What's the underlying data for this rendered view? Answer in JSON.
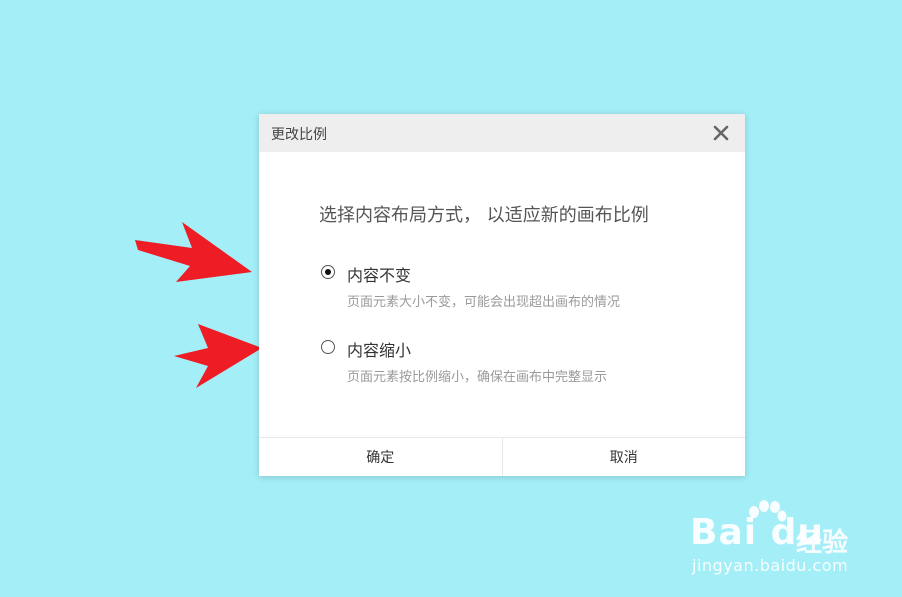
{
  "dialog": {
    "title": "更改比例",
    "prompt": "选择内容布局方式， 以适应新的画布比例",
    "options": [
      {
        "label": "内容不变",
        "description": "页面元素大小不变，可能会出现超出画布的情况",
        "checked": true
      },
      {
        "label": "内容缩小",
        "description": "页面元素按比例缩小，确保在画布中完整显示",
        "checked": false
      }
    ],
    "confirm_label": "确定",
    "cancel_label": "取消",
    "close_icon": "close-icon"
  },
  "watermark": {
    "logo_text": "Bai du",
    "jingyan_text": "经验",
    "url_text": "jingyan.baidu.com"
  },
  "colors": {
    "background": "#a3eef7",
    "arrow": "#ee1c25",
    "header": "#eeeeee"
  }
}
